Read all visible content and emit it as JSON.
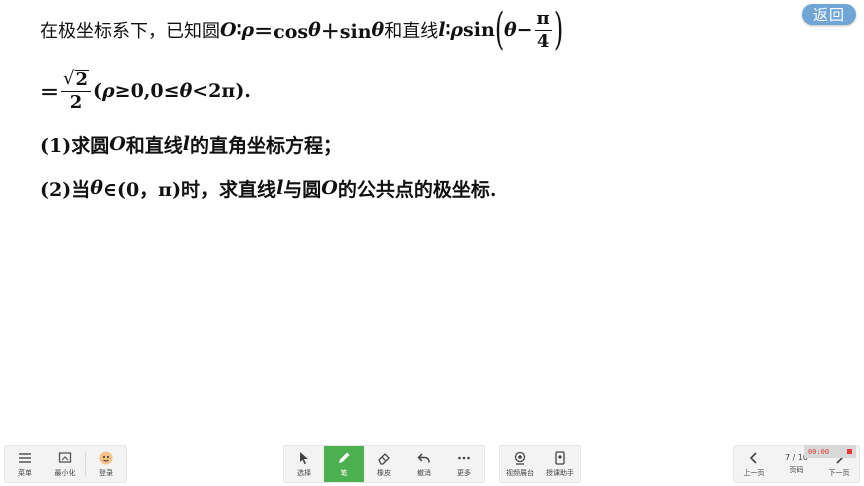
{
  "back_button": {
    "label": "返回"
  },
  "problem": {
    "line1": {
      "t1": "在极坐标系下，已知圆 ",
      "circle": "O",
      "colon1": "∶",
      "rho1": "ρ",
      "t2": "＝cos ",
      "theta1": "θ",
      "t3": "＋sin ",
      "theta2": "θ",
      "t4": " 和直线 ",
      "line_var": "l",
      "colon2": "∶",
      "rho2": "ρ",
      "t5": "sin",
      "paren_l": "(",
      "theta3": "θ",
      "minus": "−",
      "frac_num": "π",
      "frac_den": "4",
      "paren_r": ")"
    },
    "line2": {
      "eq": "＝",
      "sqrt_content": "2",
      "sqrt_sign": "√",
      "frac_den": "2",
      "p_open": "(",
      "rho": "ρ",
      "cond1": "≥0,0≤",
      "theta": "θ",
      "cond2": "<2π)."
    },
    "line3": {
      "t1": "(1)求圆 ",
      "circle": "O",
      "t2": " 和直线 ",
      "line_var": "l",
      "t3": " 的直角坐标方程；"
    },
    "line4": {
      "t1": "(2)当 ",
      "theta": "θ",
      "t2": "∈(0，π)时，求直线 ",
      "line_var": "l",
      "t3": " 与圆 ",
      "circle": "O",
      "t4": " 的公共点的极坐标."
    }
  },
  "toolbar": {
    "left": [
      {
        "label": "菜单",
        "icon": "menu-icon"
      },
      {
        "label": "最小化",
        "icon": "minimize-icon"
      },
      {
        "label": "登录",
        "icon": "avatar-icon"
      }
    ],
    "center": [
      {
        "label": "选择",
        "icon": "cursor-icon"
      },
      {
        "label": "笔",
        "icon": "pen-icon"
      },
      {
        "label": "橡皮",
        "icon": "eraser-icon"
      },
      {
        "label": "撤消",
        "icon": "undo-icon"
      },
      {
        "label": "更多",
        "icon": "more-icon"
      }
    ],
    "center_right": [
      {
        "label": "视频展台",
        "icon": "camera-icon"
      },
      {
        "label": "授课助手",
        "icon": "assistant-icon"
      }
    ],
    "right": {
      "prev_label": "上一页",
      "page_label": "页码",
      "next_label": "下一页",
      "page_indicator": "7 / 10"
    },
    "record_time": "00:00",
    "accent_color": "#4caf50"
  }
}
